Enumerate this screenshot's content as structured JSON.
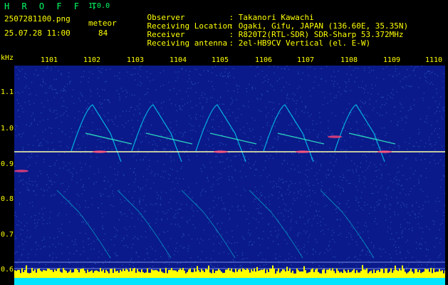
{
  "header": {
    "app_name": "H R O F F T",
    "version": "1.0.0",
    "filename": "2507281100.png",
    "datetime": "25.07.28 11:00",
    "meteor_label": "meteor",
    "meteor_count": "84"
  },
  "info": [
    {
      "label": "Observer",
      "value": ": Takanori Kawachi"
    },
    {
      "label": "Receiving Location",
      "value": ": Ogaki, Gifu, JAPAN (136.60E, 35.35N)"
    },
    {
      "label": "Receiver",
      "value": ": R820T2(RTL-SDR) SDR-Sharp 53.372MHz"
    },
    {
      "label": "Receiving antenna",
      "value": ": 2el-HB9CV Vertical (el. E-W)"
    }
  ],
  "axis": {
    "y_unit": "kHz",
    "y_ticks": [
      "1.1",
      "1.0",
      "0.9",
      "0.8",
      "0.7",
      "0.6"
    ],
    "x_ticks": [
      "1101",
      "1102",
      "1103",
      "1104",
      "1105",
      "1106",
      "1107",
      "1108",
      "1109",
      "1110"
    ]
  },
  "colors": {
    "background": "#000000",
    "text": "#ffff00",
    "title": "#00ff66",
    "plot_bg": "#0a1a8a",
    "signal": "#00e5ff",
    "carrier": "#ffffaa",
    "meteor_bar": "#ffff00"
  }
}
